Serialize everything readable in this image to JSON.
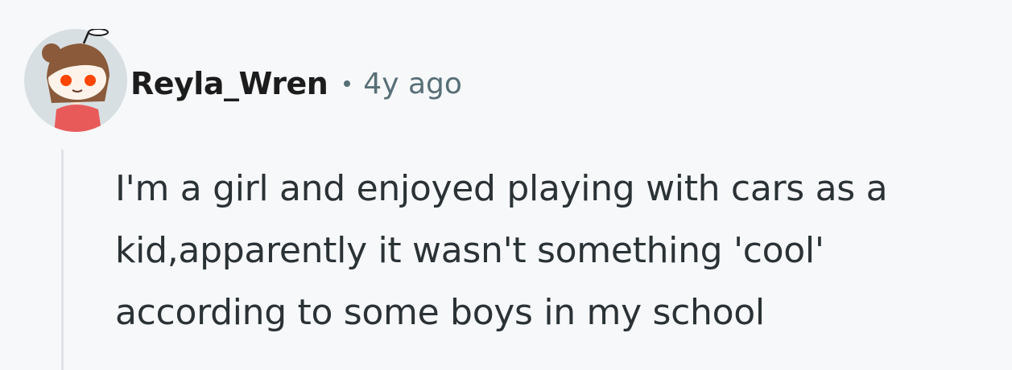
{
  "comment": {
    "author": "Reyla_Wren",
    "separator": "•",
    "timestamp": "4y ago",
    "avatar_icon": "snoo-avatar-icon",
    "text_lines": [
      "I'm a girl and enjoyed playing with cars as a",
      "kid,apparently it wasn't something 'cool'",
      "according to some boys in my school"
    ]
  },
  "colors": {
    "background": "#f7f8f9",
    "username": "#1c1c1c",
    "meta_gray": "#576f76",
    "body_text": "#2a3236",
    "thread_line": "#dfe3e6"
  }
}
